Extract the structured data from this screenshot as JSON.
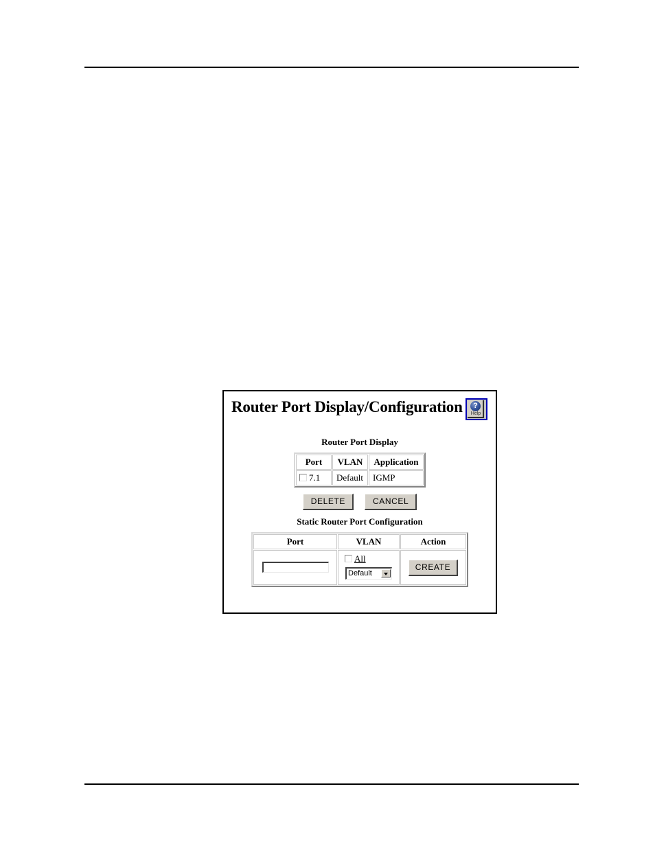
{
  "page": {
    "background": "#ffffff",
    "rule_color": "#000000"
  },
  "ui": {
    "title": "Router Port Display/Configuration",
    "help": {
      "glyph": "?",
      "label": "Help",
      "border_color": "#0000b4"
    },
    "display_section": {
      "heading": "Router Port Display",
      "columns": [
        "Port",
        "VLAN",
        "Application"
      ],
      "rows": [
        {
          "port": "7.1",
          "port_checked": false,
          "vlan": "Default",
          "application": "IGMP"
        }
      ],
      "buttons": {
        "delete": "DELETE",
        "cancel": "CANCEL"
      }
    },
    "static_section": {
      "heading": "Static Router Port Configuration",
      "columns": [
        "Port",
        "VLAN",
        "Action"
      ],
      "port_input": {
        "value": "",
        "placeholder": ""
      },
      "vlan_all": {
        "label": "All",
        "checked": false
      },
      "vlan_select": {
        "value": "Default",
        "options": [
          "Default"
        ]
      },
      "create_button": "CREATE"
    }
  }
}
